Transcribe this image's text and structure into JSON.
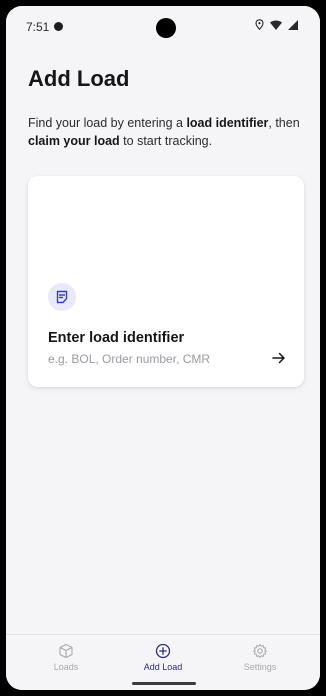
{
  "status_bar": {
    "time": "7:51"
  },
  "header": {
    "title": "Add Load"
  },
  "intro": {
    "part1": "Find your load by entering a ",
    "bold1": "load identifier",
    "part2": ", then ",
    "bold2": "claim your load",
    "part3": " to start tracking."
  },
  "card": {
    "icon": "note-icon",
    "title": "Enter load identifier",
    "subtitle": "e.g. BOL, Order number, CMR",
    "arrow_icon": "arrow-right-icon"
  },
  "bottom_nav": {
    "items": [
      {
        "label": "Loads",
        "icon": "box-icon",
        "active": false
      },
      {
        "label": "Add Load",
        "icon": "plus-circle-icon",
        "active": true
      },
      {
        "label": "Settings",
        "icon": "gear-icon",
        "active": false
      }
    ]
  },
  "colors": {
    "background": "#f5f5f7",
    "accent": "#2b2f7c",
    "icon_chip": "#e8e9fb",
    "inactive": "#a8a8b0"
  }
}
